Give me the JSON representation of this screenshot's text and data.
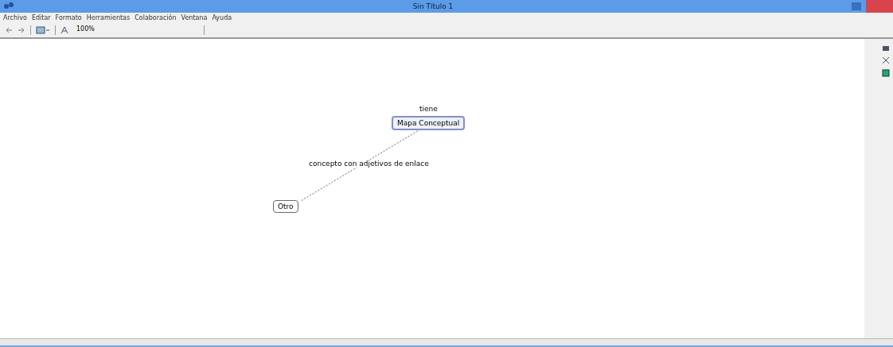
{
  "window": {
    "title": "Sin Título 1"
  },
  "menu": [
    "Archivo",
    "Editar",
    "Formato",
    "Herramientas",
    "Colaboración",
    "Ventana",
    "Ayuda"
  ],
  "toolbar": {
    "zoom": "100%"
  },
  "map": {
    "nodes": [
      {
        "label": "Mapa Conceptual",
        "selected": true
      },
      {
        "label": "Otro",
        "selected": false
      }
    ],
    "links": [
      {
        "label": "tiene"
      },
      {
        "label": "concepto con adjetivos de enlace"
      }
    ]
  }
}
